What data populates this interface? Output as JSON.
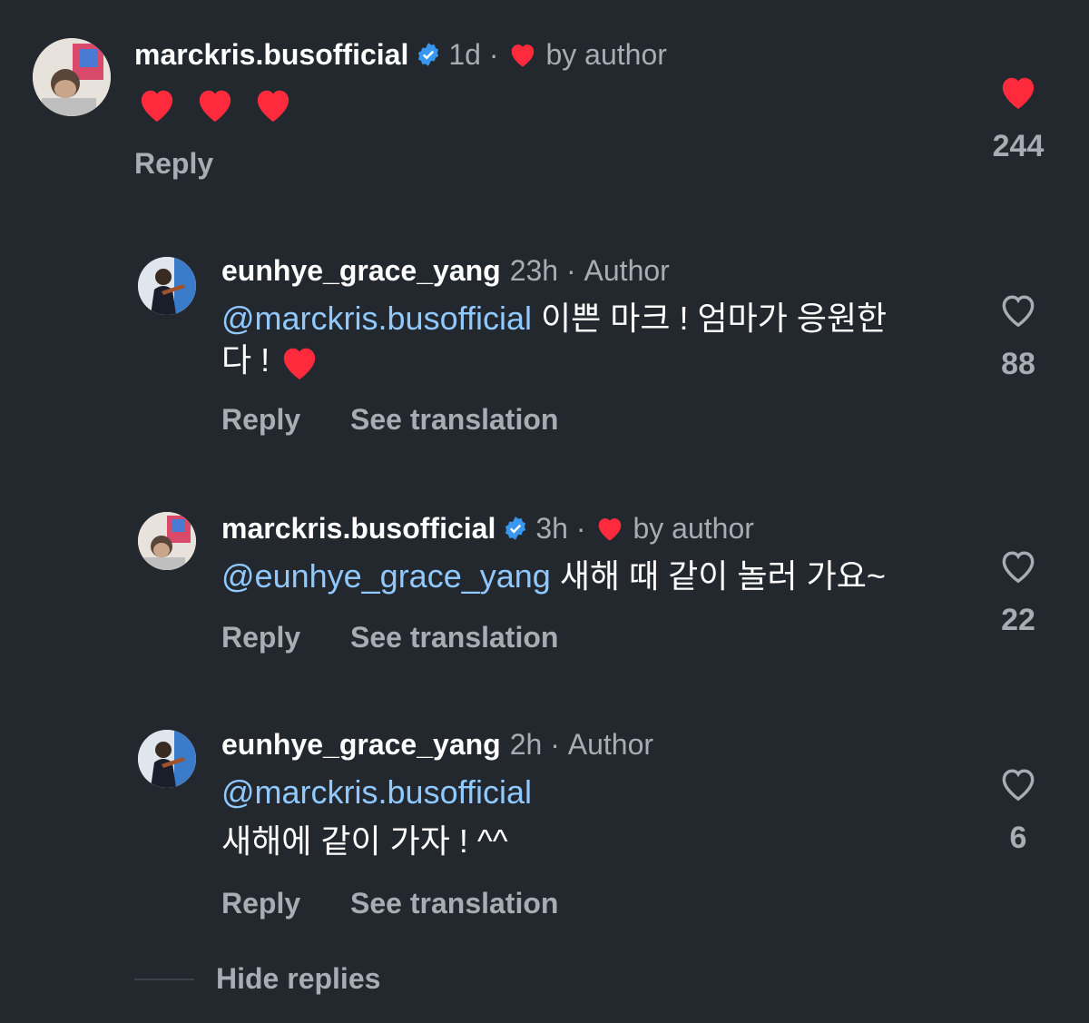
{
  "comments": [
    {
      "username": "marckris.busofficial",
      "verified": true,
      "time": "1d",
      "liked_by_author_label": "by author",
      "mention": "",
      "text": "",
      "emoji_hearts": 3,
      "actions": {
        "reply": "Reply"
      },
      "likes": "244",
      "liked": true
    },
    {
      "username": "eunhye_grace_yang",
      "verified": false,
      "time": "23h",
      "author_label": "Author",
      "mention": "@marckris.busofficial",
      "text_line1": " 이쁜 마크 ! 엄마가 응원한",
      "text_line2": "다 ! ",
      "actions": {
        "reply": "Reply",
        "translate": "See translation"
      },
      "likes": "88",
      "liked": false
    },
    {
      "username": "marckris.busofficial",
      "verified": true,
      "time": "3h",
      "liked_by_author_label": "by author",
      "mention": "@eunhye_grace_yang",
      "text": " 새해 때 같이 놀러 가요~",
      "actions": {
        "reply": "Reply",
        "translate": "See translation"
      },
      "likes": "22",
      "liked": false
    },
    {
      "username": "eunhye_grace_yang",
      "verified": false,
      "time": "2h",
      "author_label": "Author",
      "mention": "@marckris.busofficial",
      "text": "새해에 같이 가자 ! ^^",
      "actions": {
        "reply": "Reply",
        "translate": "See translation"
      },
      "likes": "6",
      "liked": false
    }
  ],
  "hide_replies": "Hide replies",
  "colors": {
    "background": "#23272e",
    "mention": "#8fc9ff",
    "muted": "#a8adb5",
    "heart": "#ff2b3d",
    "verified": "#3897f0"
  }
}
